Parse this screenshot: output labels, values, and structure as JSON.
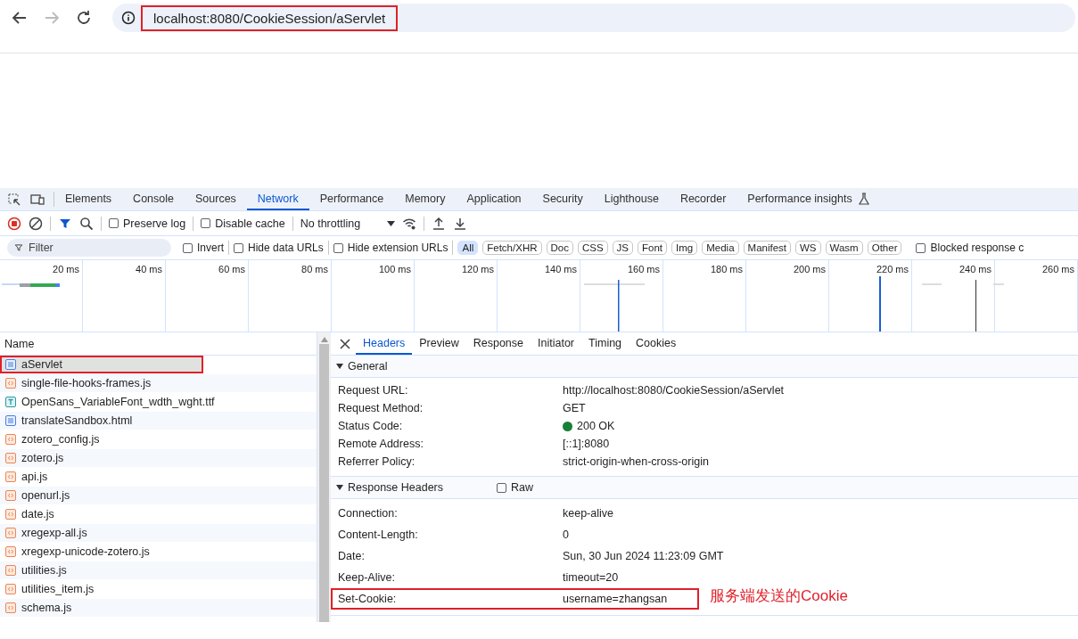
{
  "browser": {
    "url": "localhost:8080/CookieSession/aServlet",
    "url_highlighted": true,
    "back_enabled": true,
    "forward_enabled": false
  },
  "devtools": {
    "tabs": [
      {
        "label": "Elements",
        "selected": false,
        "experimental": false
      },
      {
        "label": "Console",
        "selected": false,
        "experimental": false
      },
      {
        "label": "Sources",
        "selected": false,
        "experimental": false
      },
      {
        "label": "Network",
        "selected": true,
        "experimental": false
      },
      {
        "label": "Performance",
        "selected": false,
        "experimental": false
      },
      {
        "label": "Memory",
        "selected": false,
        "experimental": false
      },
      {
        "label": "Application",
        "selected": false,
        "experimental": false
      },
      {
        "label": "Security",
        "selected": false,
        "experimental": false
      },
      {
        "label": "Lighthouse",
        "selected": false,
        "experimental": false
      },
      {
        "label": "Recorder",
        "selected": false,
        "experimental": false
      },
      {
        "label": "Performance insights",
        "selected": false,
        "experimental": true
      }
    ]
  },
  "toolbar": {
    "recording": true,
    "options": [
      {
        "label": "Preserve log",
        "checked": false
      },
      {
        "label": "Disable cache",
        "checked": false
      }
    ],
    "throttling": "No throttling"
  },
  "filter": {
    "placeholder": "Filter",
    "options": [
      {
        "label": "Invert",
        "checked": false
      },
      {
        "label": "Hide data URLs",
        "checked": false
      },
      {
        "label": "Hide extension URLs",
        "checked": false
      }
    ],
    "types": [
      {
        "label": "All",
        "selected": true
      },
      {
        "label": "Fetch/XHR",
        "selected": false
      },
      {
        "label": "Doc",
        "selected": false
      },
      {
        "label": "CSS",
        "selected": false
      },
      {
        "label": "JS",
        "selected": false
      },
      {
        "label": "Font",
        "selected": false
      },
      {
        "label": "Img",
        "selected": false
      },
      {
        "label": "Media",
        "selected": false
      },
      {
        "label": "Manifest",
        "selected": false
      },
      {
        "label": "WS",
        "selected": false
      },
      {
        "label": "Wasm",
        "selected": false
      },
      {
        "label": "Other",
        "selected": false
      }
    ],
    "blocked": {
      "label": "Blocked response c",
      "checked": false
    }
  },
  "timeline": {
    "ticks": [
      "20 ms",
      "40 ms",
      "60 ms",
      "80 ms",
      "100 ms",
      "120 ms",
      "140 ms",
      "160 ms",
      "180 ms",
      "200 ms",
      "220 ms",
      "240 ms",
      "260 ms"
    ]
  },
  "requests": {
    "column": "Name",
    "rows": [
      {
        "name": "aServlet",
        "kind": "doc",
        "selected": true,
        "highlighted": true
      },
      {
        "name": "single-file-hooks-frames.js",
        "kind": "script",
        "selected": false,
        "highlighted": false
      },
      {
        "name": "OpenSans_VariableFont_wdth_wght.ttf",
        "kind": "font",
        "selected": false,
        "highlighted": false
      },
      {
        "name": "translateSandbox.html",
        "kind": "doc",
        "selected": false,
        "highlighted": false
      },
      {
        "name": "zotero_config.js",
        "kind": "script",
        "selected": false,
        "highlighted": false
      },
      {
        "name": "zotero.js",
        "kind": "script",
        "selected": false,
        "highlighted": false
      },
      {
        "name": "api.js",
        "kind": "script",
        "selected": false,
        "highlighted": false
      },
      {
        "name": "openurl.js",
        "kind": "script",
        "selected": false,
        "highlighted": false
      },
      {
        "name": "date.js",
        "kind": "script",
        "selected": false,
        "highlighted": false
      },
      {
        "name": "xregexp-all.js",
        "kind": "script",
        "selected": false,
        "highlighted": false
      },
      {
        "name": "xregexp-unicode-zotero.js",
        "kind": "script",
        "selected": false,
        "highlighted": false
      },
      {
        "name": "utilities.js",
        "kind": "script",
        "selected": false,
        "highlighted": false
      },
      {
        "name": "utilities_item.js",
        "kind": "script",
        "selected": false,
        "highlighted": false
      },
      {
        "name": "schema.js",
        "kind": "script",
        "selected": false,
        "highlighted": false
      }
    ]
  },
  "details": {
    "tabs": [
      {
        "label": "Headers",
        "selected": true
      },
      {
        "label": "Preview",
        "selected": false
      },
      {
        "label": "Response",
        "selected": false
      },
      {
        "label": "Initiator",
        "selected": false
      },
      {
        "label": "Timing",
        "selected": false
      },
      {
        "label": "Cookies",
        "selected": false
      }
    ],
    "sections": [
      {
        "title": "General",
        "expanded": true,
        "kind": "compact",
        "rows": [
          {
            "name": "Request URL:",
            "value": "http://localhost:8080/CookieSession/aServlet",
            "status": false,
            "highlighted": false
          },
          {
            "name": "Request Method:",
            "value": "GET",
            "status": false,
            "highlighted": false
          },
          {
            "name": "Status Code:",
            "value": "200 OK",
            "status": true,
            "highlighted": false
          },
          {
            "name": "Remote Address:",
            "value": "[::1]:8080",
            "status": false,
            "highlighted": false
          },
          {
            "name": "Referrer Policy:",
            "value": "strict-origin-when-cross-origin",
            "status": false,
            "highlighted": false
          }
        ]
      },
      {
        "title": "Response Headers",
        "expanded": true,
        "kind": "wide",
        "raw": {
          "label": "Raw",
          "checked": false
        },
        "rows": [
          {
            "name": "Connection:",
            "value": "keep-alive",
            "status": false,
            "highlighted": false
          },
          {
            "name": "Content-Length:",
            "value": "0",
            "status": false,
            "highlighted": false
          },
          {
            "name": "Date:",
            "value": "Sun, 30 Jun 2024 11:23:09 GMT",
            "status": false,
            "highlighted": false
          },
          {
            "name": "Keep-Alive:",
            "value": "timeout=20",
            "status": false,
            "highlighted": false
          },
          {
            "name": "Set-Cookie:",
            "value": "username=zhangsan",
            "status": false,
            "highlighted": true
          }
        ]
      }
    ],
    "annotation": "服务端发送的Cookie"
  }
}
